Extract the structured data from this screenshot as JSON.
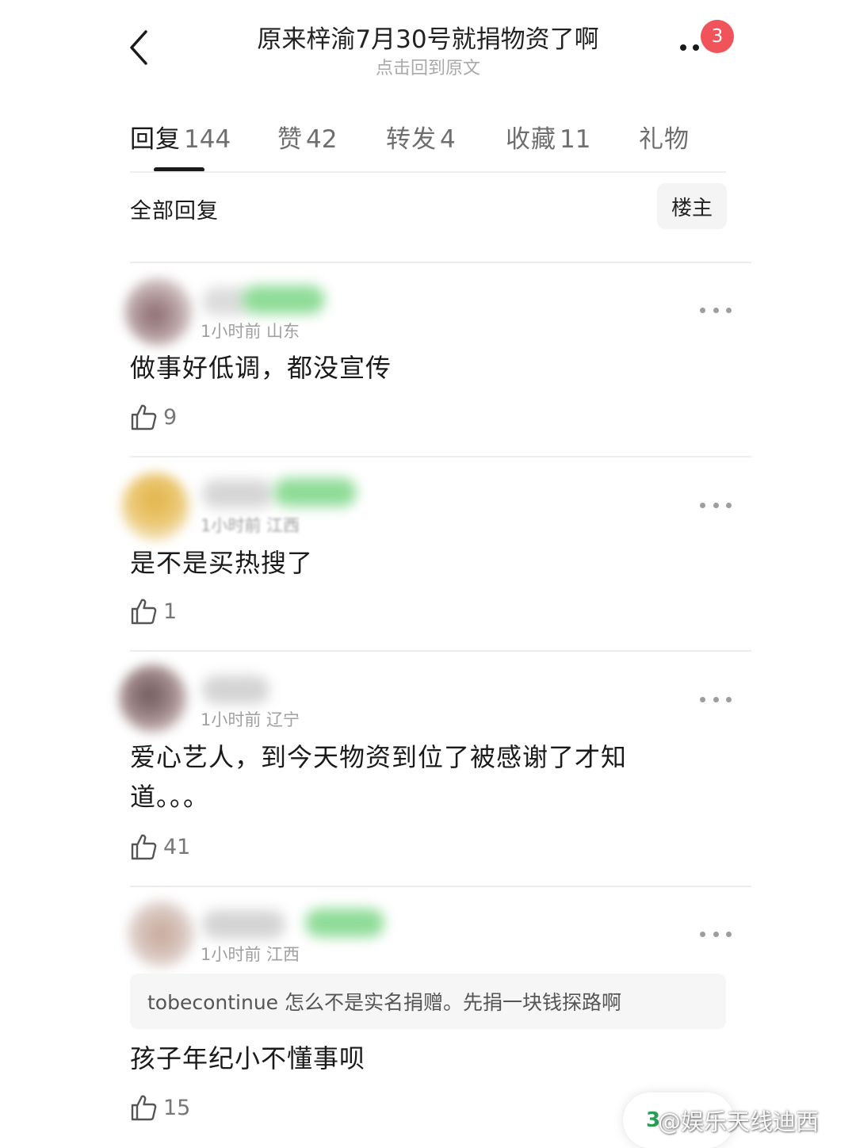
{
  "header": {
    "title": "原来梓渝7月30号就捐物资了啊",
    "subtitle": "点击回到原文",
    "badge_count": "3"
  },
  "tabs": [
    {
      "name": "回复",
      "count": "144"
    },
    {
      "name": "赞",
      "count": "42"
    },
    {
      "name": "转发",
      "count": "4"
    },
    {
      "name": "收藏",
      "count": "11"
    },
    {
      "name": "礼物",
      "count": ""
    }
  ],
  "filter": {
    "label": "全部回复",
    "button": "楼主"
  },
  "comments": [
    {
      "meta": "1小时前 山东",
      "text": "做事好低调，都没宣传",
      "likes": "9"
    },
    {
      "meta": "1小时前 江西",
      "text": "是不是买热搜了",
      "likes": "1"
    },
    {
      "meta": "1小时前 辽宁",
      "text": "爱心艺人，到今天物资到位了被感谢了才知道。。。",
      "likes": "41"
    },
    {
      "meta": "1小时前 江西",
      "quote": "tobecontinue 怎么不是实名捐赠。先捐一块钱探路啊",
      "text": "孩子年纪小不懂事呗",
      "likes": "15"
    }
  ],
  "footer": {
    "page": "3",
    "watermark": "@娱乐天线迪西"
  },
  "colors": {
    "badge": "#f0535a",
    "name_tag_green": "#7fd88a",
    "page_green": "#2a9d55"
  }
}
